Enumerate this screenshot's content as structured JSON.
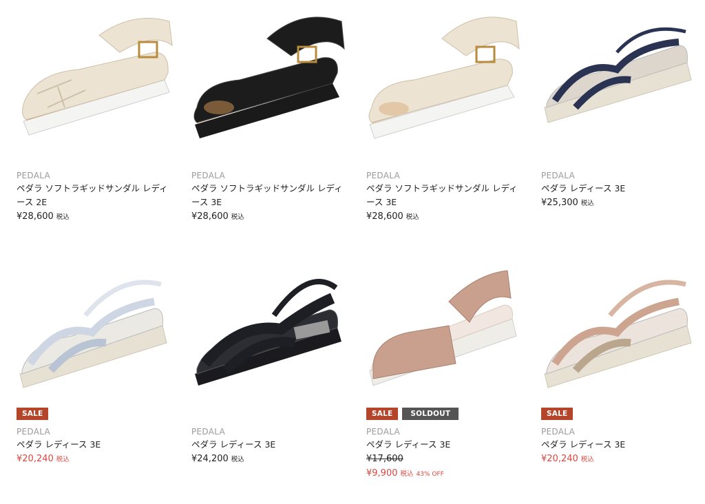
{
  "products": [
    {
      "brand": "PEDALA",
      "name": "ペダラ ソフトラギッドサンダル レディース 2E",
      "price": "¥28,600",
      "tax": "税込",
      "colors": {
        "upper": "#ece3d3",
        "sole": "#f4f4f2"
      }
    },
    {
      "brand": "PEDALA",
      "name": "ペダラ ソフトラギッドサンダル レディース 3E",
      "price": "¥28,600",
      "tax": "税込",
      "colors": {
        "upper": "#1c1c1c",
        "sole": "#1a1a1a"
      }
    },
    {
      "brand": "PEDALA",
      "name": "ペダラ ソフトラギッドサンダル レディース 3E",
      "price": "¥28,600",
      "tax": "税込",
      "colors": {
        "upper": "#ece3d3",
        "sole": "#f4f4f2"
      }
    },
    {
      "brand": "PEDALA",
      "name": "ペダラ レディース 3E",
      "price": "¥25,300",
      "tax": "税込",
      "colors": {
        "upper": "#2a3352",
        "sole": "#e7e1d4"
      }
    },
    {
      "badges": [
        "SALE"
      ],
      "brand": "PEDALA",
      "name": "ペダラ レディース 3E",
      "price": "¥20,240",
      "tax": "税込",
      "colors": {
        "upper": "#cdd6e2",
        "sole": "#e7e1d4"
      }
    },
    {
      "brand": "PEDALA",
      "name": "ペダラ レディース 3E",
      "price": "¥24,200",
      "tax": "税込",
      "colors": {
        "upper": "#1d1f25",
        "sole": "#1b1b1f"
      }
    },
    {
      "badges": [
        "SALE",
        "SOLDOUT"
      ],
      "brand": "PEDALA",
      "name": "ペダラ レディース 3E",
      "original_price": "¥17,600",
      "price": "¥9,900",
      "tax": "税込",
      "discount": "43% OFF",
      "colors": {
        "upper": "#c9a08d",
        "sole": "#efede7"
      }
    },
    {
      "badges": [
        "SALE"
      ],
      "brand": "PEDALA",
      "name": "ペダラ レディース 3E",
      "price": "¥20,240",
      "tax": "税込",
      "colors": {
        "upper": "#cda48f",
        "sole": "#e7e1d4"
      }
    }
  ]
}
